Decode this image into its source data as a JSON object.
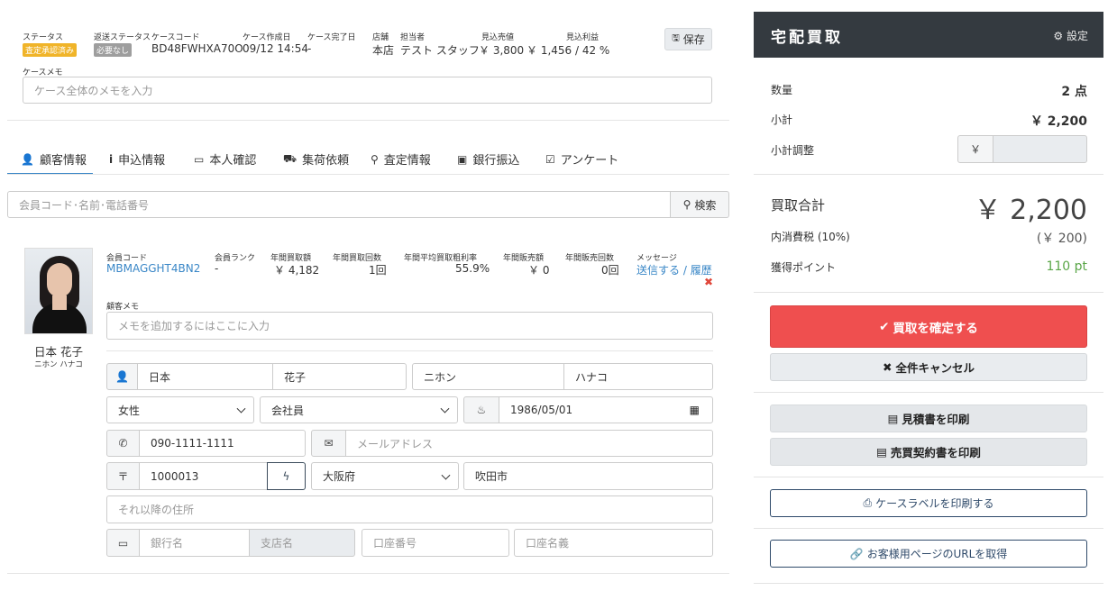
{
  "case": {
    "status_label": "ステータス",
    "status_badge": "査定承認済み",
    "return_status_label": "返送ステータス",
    "return_status_badge": "必要なし",
    "case_code_label": "ケースコード",
    "case_code": "BD48FWHXA70O",
    "created_label": "ケース作成日",
    "created": "09/12 14:54",
    "completed_label": "ケース完了日",
    "completed": "-",
    "store_label": "店舗",
    "store": "本店",
    "staff_label": "担当者",
    "staff": "テスト スタッフ",
    "est_sales_label": "見込売値",
    "est_sales": "￥ 3,800",
    "est_profit_label": "見込利益",
    "est_profit": "￥ 1,456 / 42 %",
    "save_label": "保存",
    "memo_label": "ケースメモ",
    "memo_placeholder": "ケース全体のメモを入力"
  },
  "tabs": [
    {
      "label": "顧客情報",
      "icon": "user-icon"
    },
    {
      "label": "申込情報",
      "icon": "info-icon"
    },
    {
      "label": "本人確認",
      "icon": "id-card-icon"
    },
    {
      "label": "集荷依頼",
      "icon": "truck-icon"
    },
    {
      "label": "査定情報",
      "icon": "search-icon"
    },
    {
      "label": "銀行振込",
      "icon": "money-icon"
    },
    {
      "label": "アンケート",
      "icon": "checkbox-icon"
    }
  ],
  "search": {
    "placeholder": "会員コード･名前･電話番号",
    "button": "検索"
  },
  "customer": {
    "name": "日本 花子",
    "kana": "ニホン ハナコ",
    "member_code_label": "会員コード",
    "member_code": "MBMAGGHT4BN2",
    "rank_label": "会員ランク",
    "rank": "-",
    "annual_buy_amount_label": "年間買取額",
    "annual_buy_amount": "￥ 4,182",
    "annual_buy_count_label": "年間買取回数",
    "annual_buy_count": "1回",
    "avg_margin_label": "年間平均買取粗利率",
    "avg_margin": "55.9%",
    "annual_sales_label": "年間販売額",
    "annual_sales": "￥ 0",
    "annual_sales_count_label": "年間販売回数",
    "annual_sales_count": "0回",
    "message_label": "メッセージ",
    "send_link": "送信する",
    "separator": " / ",
    "history_link": "履歴",
    "memo_label": "顧客メモ",
    "memo_placeholder": "メモを追加するにはここに入力"
  },
  "form": {
    "last_name": "日本",
    "first_name": "花子",
    "last_kana": "ニホン",
    "first_kana": "ハナコ",
    "gender": "女性",
    "member_type": "会社員",
    "birthday": "1986/05/01",
    "phone": "090-1111-1111",
    "email_placeholder": "メールアドレス",
    "postal_symbol": "〒",
    "postal": "1000013",
    "prefecture": "大阪府",
    "city": "吹田市",
    "address_placeholder": "それ以降の住所",
    "bank_placeholder": "銀行名",
    "branch_placeholder": "支店名",
    "account_no_placeholder": "口座番号",
    "account_name_placeholder": "口座名義"
  },
  "panel": {
    "title": "宅配買取",
    "settings": "設定",
    "qty_label": "数量",
    "qty": "2 点",
    "subtotal_label": "小計",
    "subtotal": "￥ 2,200",
    "adjust_label": "小計調整",
    "yen": "￥",
    "total_label": "買取合計",
    "total": "￥ 2,200",
    "tax_label": "内消費税 (10%)",
    "tax": "(￥ 200)",
    "points_label": "獲得ポイント",
    "points": "110 pt",
    "confirm": "買取を確定する",
    "cancel_all": "全件キャンセル",
    "print_estimate": "見積書を印刷",
    "print_contract": "売買契約書を印刷",
    "print_label": "ケースラベルを印刷する",
    "get_url": "お客様用ページのURLを取得"
  },
  "colors": {
    "accent": "#3a87c7",
    "badge_yellow": "#f0b429",
    "badge_gray": "#9e9e9e",
    "danger": "#ef4f4f",
    "header_dark": "#343a40",
    "points_green": "#5aa648"
  }
}
